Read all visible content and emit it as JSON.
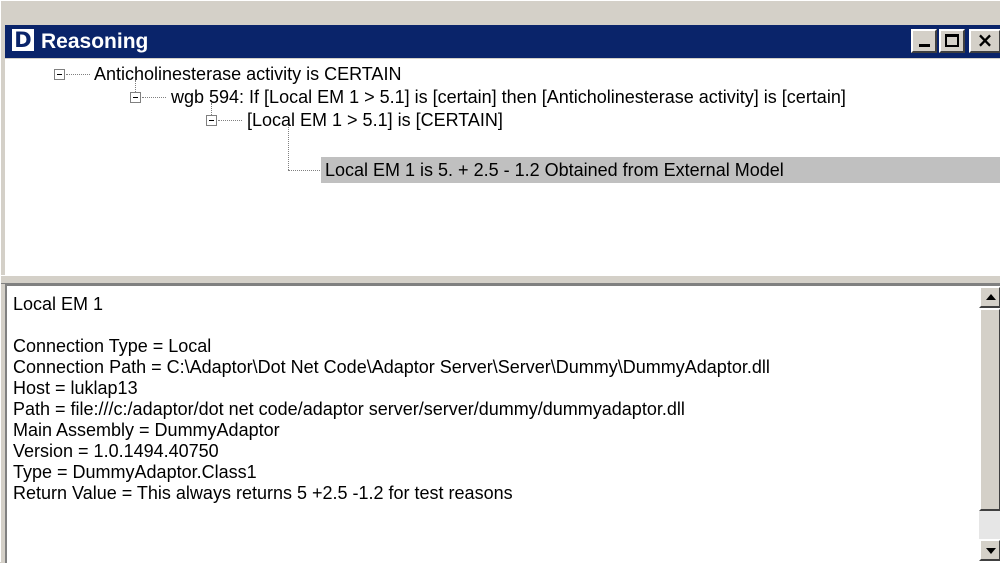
{
  "window": {
    "icon_letter": "D",
    "title": "Reasoning"
  },
  "tree": {
    "nodes": [
      {
        "label": "Anticholinesterase activity is CERTAIN"
      },
      {
        "label": "wgb 594: If  [Local EM 1 > 5.1]  is  [certain]  then  [Anticholinesterase activity]  is  [certain]"
      },
      {
        "label": "[Local EM 1 > 5.1]  is  [CERTAIN]"
      },
      {
        "label": "Local EM 1 is 5.  + 2.5 - 1.2  Obtained from External Model"
      }
    ]
  },
  "details": {
    "heading": "Local EM 1",
    "lines": [
      "Connection Type =  Local",
      "Connection Path =  C:\\Adaptor\\Dot Net Code\\Adaptor Server\\Server\\Dummy\\DummyAdaptor.dll",
      "Host =  luklap13",
      "Path =  file:///c:/adaptor/dot net code/adaptor server/server/dummy/dummyadaptor.dll",
      "Main Assembly =  DummyAdaptor",
      "Version =  1.0.1494.40750",
      "Type =  DummyAdaptor.Class1",
      "Return Value =  This always returns 5 +2.5 -1.2 for test reasons"
    ]
  },
  "colors": {
    "titlebar": "#0a246a",
    "selection": "#c0c0c0",
    "window_face": "#d4d0c8"
  }
}
